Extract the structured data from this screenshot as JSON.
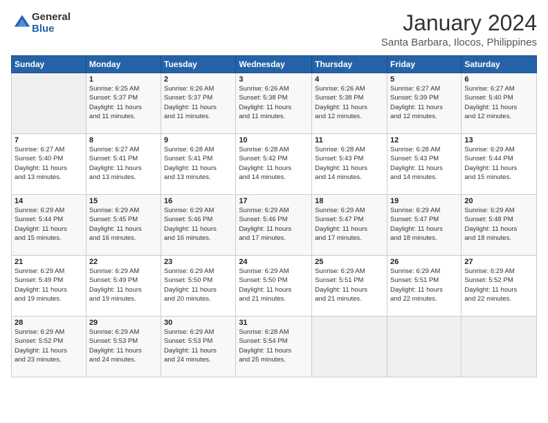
{
  "logo": {
    "text_general": "General",
    "text_blue": "Blue"
  },
  "title": {
    "month_year": "January 2024",
    "location": "Santa Barbara, Ilocos, Philippines"
  },
  "headers": [
    "Sunday",
    "Monday",
    "Tuesday",
    "Wednesday",
    "Thursday",
    "Friday",
    "Saturday"
  ],
  "weeks": [
    [
      {
        "day": "",
        "info": ""
      },
      {
        "day": "1",
        "info": "Sunrise: 6:25 AM\nSunset: 5:37 PM\nDaylight: 11 hours\nand 11 minutes."
      },
      {
        "day": "2",
        "info": "Sunrise: 6:26 AM\nSunset: 5:37 PM\nDaylight: 11 hours\nand 11 minutes."
      },
      {
        "day": "3",
        "info": "Sunrise: 6:26 AM\nSunset: 5:38 PM\nDaylight: 11 hours\nand 11 minutes."
      },
      {
        "day": "4",
        "info": "Sunrise: 6:26 AM\nSunset: 5:38 PM\nDaylight: 11 hours\nand 12 minutes."
      },
      {
        "day": "5",
        "info": "Sunrise: 6:27 AM\nSunset: 5:39 PM\nDaylight: 11 hours\nand 12 minutes."
      },
      {
        "day": "6",
        "info": "Sunrise: 6:27 AM\nSunset: 5:40 PM\nDaylight: 11 hours\nand 12 minutes."
      }
    ],
    [
      {
        "day": "7",
        "info": "Sunrise: 6:27 AM\nSunset: 5:40 PM\nDaylight: 11 hours\nand 13 minutes."
      },
      {
        "day": "8",
        "info": "Sunrise: 6:27 AM\nSunset: 5:41 PM\nDaylight: 11 hours\nand 13 minutes."
      },
      {
        "day": "9",
        "info": "Sunrise: 6:28 AM\nSunset: 5:41 PM\nDaylight: 11 hours\nand 13 minutes."
      },
      {
        "day": "10",
        "info": "Sunrise: 6:28 AM\nSunset: 5:42 PM\nDaylight: 11 hours\nand 14 minutes."
      },
      {
        "day": "11",
        "info": "Sunrise: 6:28 AM\nSunset: 5:43 PM\nDaylight: 11 hours\nand 14 minutes."
      },
      {
        "day": "12",
        "info": "Sunrise: 6:28 AM\nSunset: 5:43 PM\nDaylight: 11 hours\nand 14 minutes."
      },
      {
        "day": "13",
        "info": "Sunrise: 6:29 AM\nSunset: 5:44 PM\nDaylight: 11 hours\nand 15 minutes."
      }
    ],
    [
      {
        "day": "14",
        "info": "Sunrise: 6:29 AM\nSunset: 5:44 PM\nDaylight: 11 hours\nand 15 minutes."
      },
      {
        "day": "15",
        "info": "Sunrise: 6:29 AM\nSunset: 5:45 PM\nDaylight: 11 hours\nand 16 minutes."
      },
      {
        "day": "16",
        "info": "Sunrise: 6:29 AM\nSunset: 5:46 PM\nDaylight: 11 hours\nand 16 minutes."
      },
      {
        "day": "17",
        "info": "Sunrise: 6:29 AM\nSunset: 5:46 PM\nDaylight: 11 hours\nand 17 minutes."
      },
      {
        "day": "18",
        "info": "Sunrise: 6:29 AM\nSunset: 5:47 PM\nDaylight: 11 hours\nand 17 minutes."
      },
      {
        "day": "19",
        "info": "Sunrise: 6:29 AM\nSunset: 5:47 PM\nDaylight: 11 hours\nand 18 minutes."
      },
      {
        "day": "20",
        "info": "Sunrise: 6:29 AM\nSunset: 5:48 PM\nDaylight: 11 hours\nand 18 minutes."
      }
    ],
    [
      {
        "day": "21",
        "info": "Sunrise: 6:29 AM\nSunset: 5:49 PM\nDaylight: 11 hours\nand 19 minutes."
      },
      {
        "day": "22",
        "info": "Sunrise: 6:29 AM\nSunset: 5:49 PM\nDaylight: 11 hours\nand 19 minutes."
      },
      {
        "day": "23",
        "info": "Sunrise: 6:29 AM\nSunset: 5:50 PM\nDaylight: 11 hours\nand 20 minutes."
      },
      {
        "day": "24",
        "info": "Sunrise: 6:29 AM\nSunset: 5:50 PM\nDaylight: 11 hours\nand 21 minutes."
      },
      {
        "day": "25",
        "info": "Sunrise: 6:29 AM\nSunset: 5:51 PM\nDaylight: 11 hours\nand 21 minutes."
      },
      {
        "day": "26",
        "info": "Sunrise: 6:29 AM\nSunset: 5:51 PM\nDaylight: 11 hours\nand 22 minutes."
      },
      {
        "day": "27",
        "info": "Sunrise: 6:29 AM\nSunset: 5:52 PM\nDaylight: 11 hours\nand 22 minutes."
      }
    ],
    [
      {
        "day": "28",
        "info": "Sunrise: 6:29 AM\nSunset: 5:52 PM\nDaylight: 11 hours\nand 23 minutes."
      },
      {
        "day": "29",
        "info": "Sunrise: 6:29 AM\nSunset: 5:53 PM\nDaylight: 11 hours\nand 24 minutes."
      },
      {
        "day": "30",
        "info": "Sunrise: 6:29 AM\nSunset: 5:53 PM\nDaylight: 11 hours\nand 24 minutes."
      },
      {
        "day": "31",
        "info": "Sunrise: 6:28 AM\nSunset: 5:54 PM\nDaylight: 11 hours\nand 25 minutes."
      },
      {
        "day": "",
        "info": ""
      },
      {
        "day": "",
        "info": ""
      },
      {
        "day": "",
        "info": ""
      }
    ]
  ]
}
